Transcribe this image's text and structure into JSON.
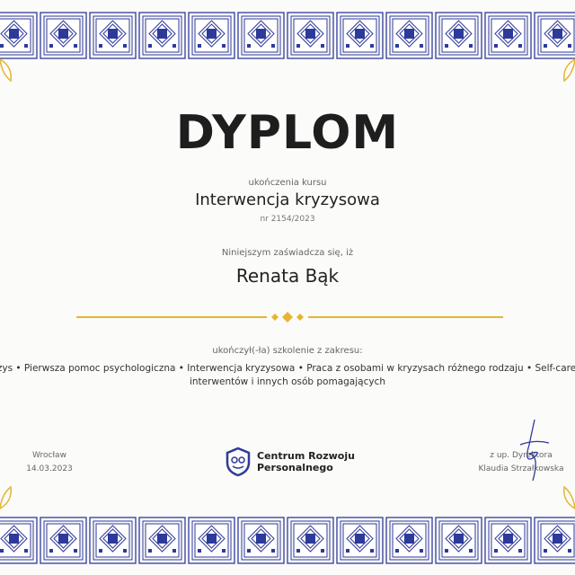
{
  "title": "DYPLOM",
  "subtitle": "ukończenia kursu",
  "course": "Interwencja kryzysowa",
  "number": "nr 2154/2023",
  "certify": "Niniejszym zaświadcza się, iż",
  "recipient": "Renata Bąk",
  "range_label": "ukończył(-ła) szkolenie z zakresu:",
  "topics_line1": "Kryzys • Pierwsza pomoc psychologiczna • Interwencja kryzysowa • Praca z osobami w kryzysach różnego rodzaju • Self-care dla",
  "topics_line2": "interwentów i innych osób pomagających",
  "place": "Wrocław",
  "date": "14.03.2023",
  "org_line1": "Centrum Rozwoju",
  "org_line2": "Personalnego",
  "signer_role": "z up. Dyrektora",
  "signer_name": "Klaudia Strzałkowska",
  "colors": {
    "border": "#2e3a9a",
    "accent": "#e5b632",
    "text": "#1e1e1e"
  }
}
